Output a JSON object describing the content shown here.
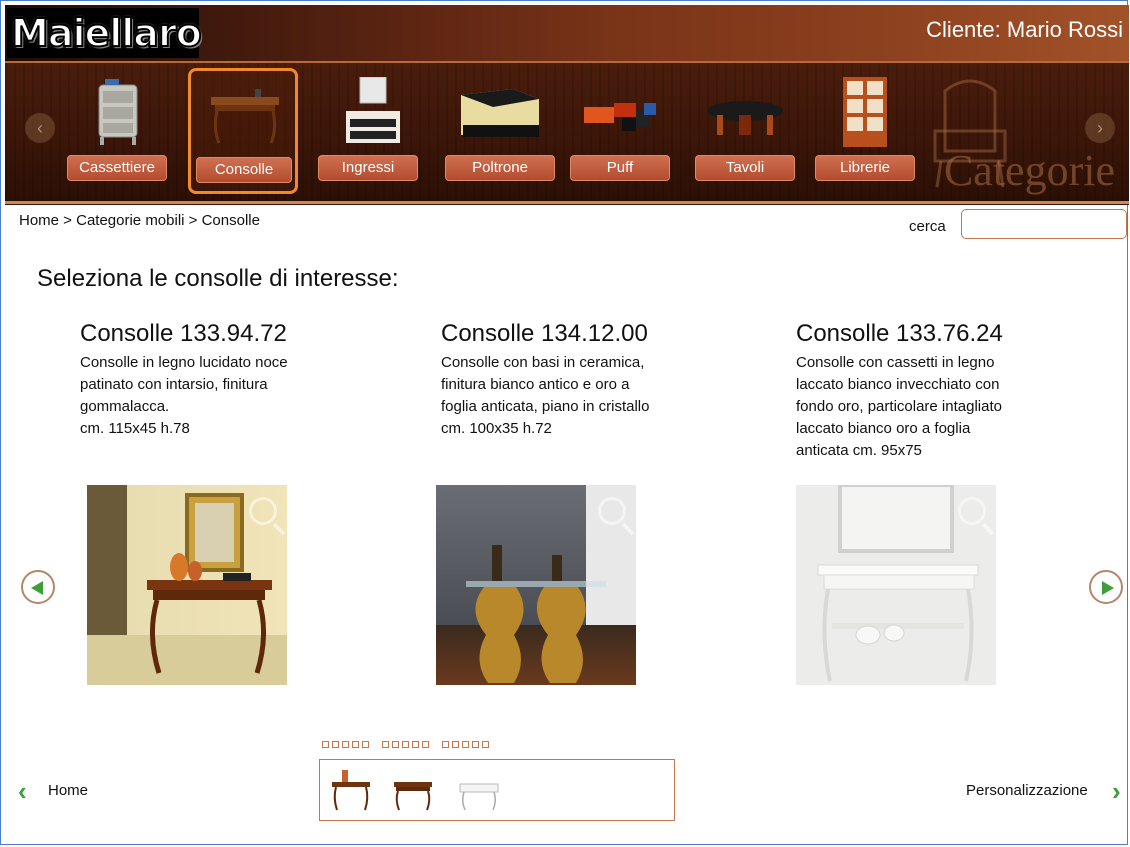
{
  "header": {
    "logo_text": "Maiellaro",
    "client_label": "Cliente: Mario Rossi",
    "categories_watermark": "Categorie",
    "categories": [
      {
        "label": "Cassettiere",
        "icon": "chest-of-drawers-icon",
        "active": false
      },
      {
        "label": "Consolle",
        "icon": "console-table-icon",
        "active": true
      },
      {
        "label": "Ingressi",
        "icon": "entryway-furniture-icon",
        "active": false
      },
      {
        "label": "Poltrone",
        "icon": "armchair-icon",
        "active": false
      },
      {
        "label": "Puff",
        "icon": "ottoman-icon",
        "active": false
      },
      {
        "label": "Tavoli",
        "icon": "table-icon",
        "active": false
      },
      {
        "label": "Librerie",
        "icon": "bookcase-icon",
        "active": false
      }
    ]
  },
  "breadcrumb": "Home > Categorie mobili > Consolle",
  "search": {
    "label": "cerca",
    "value": "",
    "placeholder": ""
  },
  "page_heading": "Seleziona le consolle di interesse:",
  "products": [
    {
      "name": "Consolle 133.94.72",
      "desc_lines": [
        "Consolle in legno lucidato noce",
        "patinato con intarsio, finitura",
        "gommalacca.",
        "cm. 115x45 h.78"
      ]
    },
    {
      "name": "Consolle 134.12.00",
      "desc_lines": [
        "Consolle con basi in ceramica,",
        "finitura bianco antico e oro a",
        "foglia anticata, piano in cristallo",
        "cm. 100x35 h.72"
      ]
    },
    {
      "name": "Consolle 133.76.24",
      "desc_lines": [
        "Consolle con cassetti in legno",
        "laccato bianco invecchiato con",
        "fondo oro, particolare intagliato",
        "laccato bianco oro a foglia",
        "anticata cm. 95x75"
      ]
    }
  ],
  "bottom_nav": {
    "back_label": "Home",
    "next_label": "Personalizzazione"
  },
  "colors": {
    "accent_green": "#3f9e3a",
    "accent_orange": "#f08a2a",
    "border_brown": "#c4774f"
  }
}
